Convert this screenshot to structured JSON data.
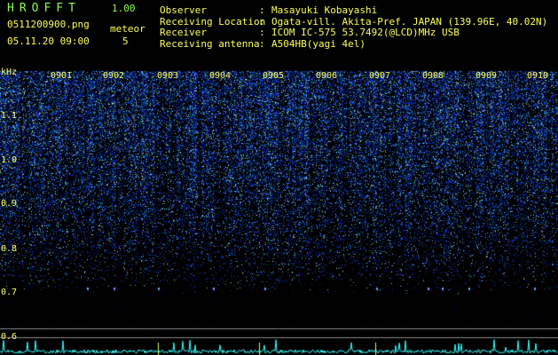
{
  "app": {
    "title": "HROFFT",
    "version": "1.00"
  },
  "file": {
    "name": "0511200900.png",
    "datetime": "05.11.20 09:00"
  },
  "meteor": {
    "label": "meteor",
    "count": "5"
  },
  "info": [
    {
      "label": "Observer",
      "value": "Masayuki Kobayashi"
    },
    {
      "label": "Receiving Location",
      "value": "Ogata-vill. Akita-Pref. JAPAN (139.96E, 40.02N)"
    },
    {
      "label": "Receiver",
      "value": "ICOM IC-575 53.7492(@LCD)MHz USB"
    },
    {
      "label": "Receiving antenna",
      "value": "A504HB(yagi 4el)"
    }
  ],
  "x_ticks": [
    "0901",
    "0902",
    "0903",
    "0904",
    "0905",
    "0906",
    "0907",
    "0908",
    "0909",
    "0910"
  ],
  "y_axis": {
    "unit": "kHz",
    "ticks": [
      "1.1",
      "1.0",
      "0.9",
      "0.8",
      "0.7",
      "0.6"
    ]
  },
  "colors": {
    "label": "#ffff55",
    "title": "#8cff4a",
    "signal": "#3a6bff",
    "trace": "#33ffff"
  }
}
